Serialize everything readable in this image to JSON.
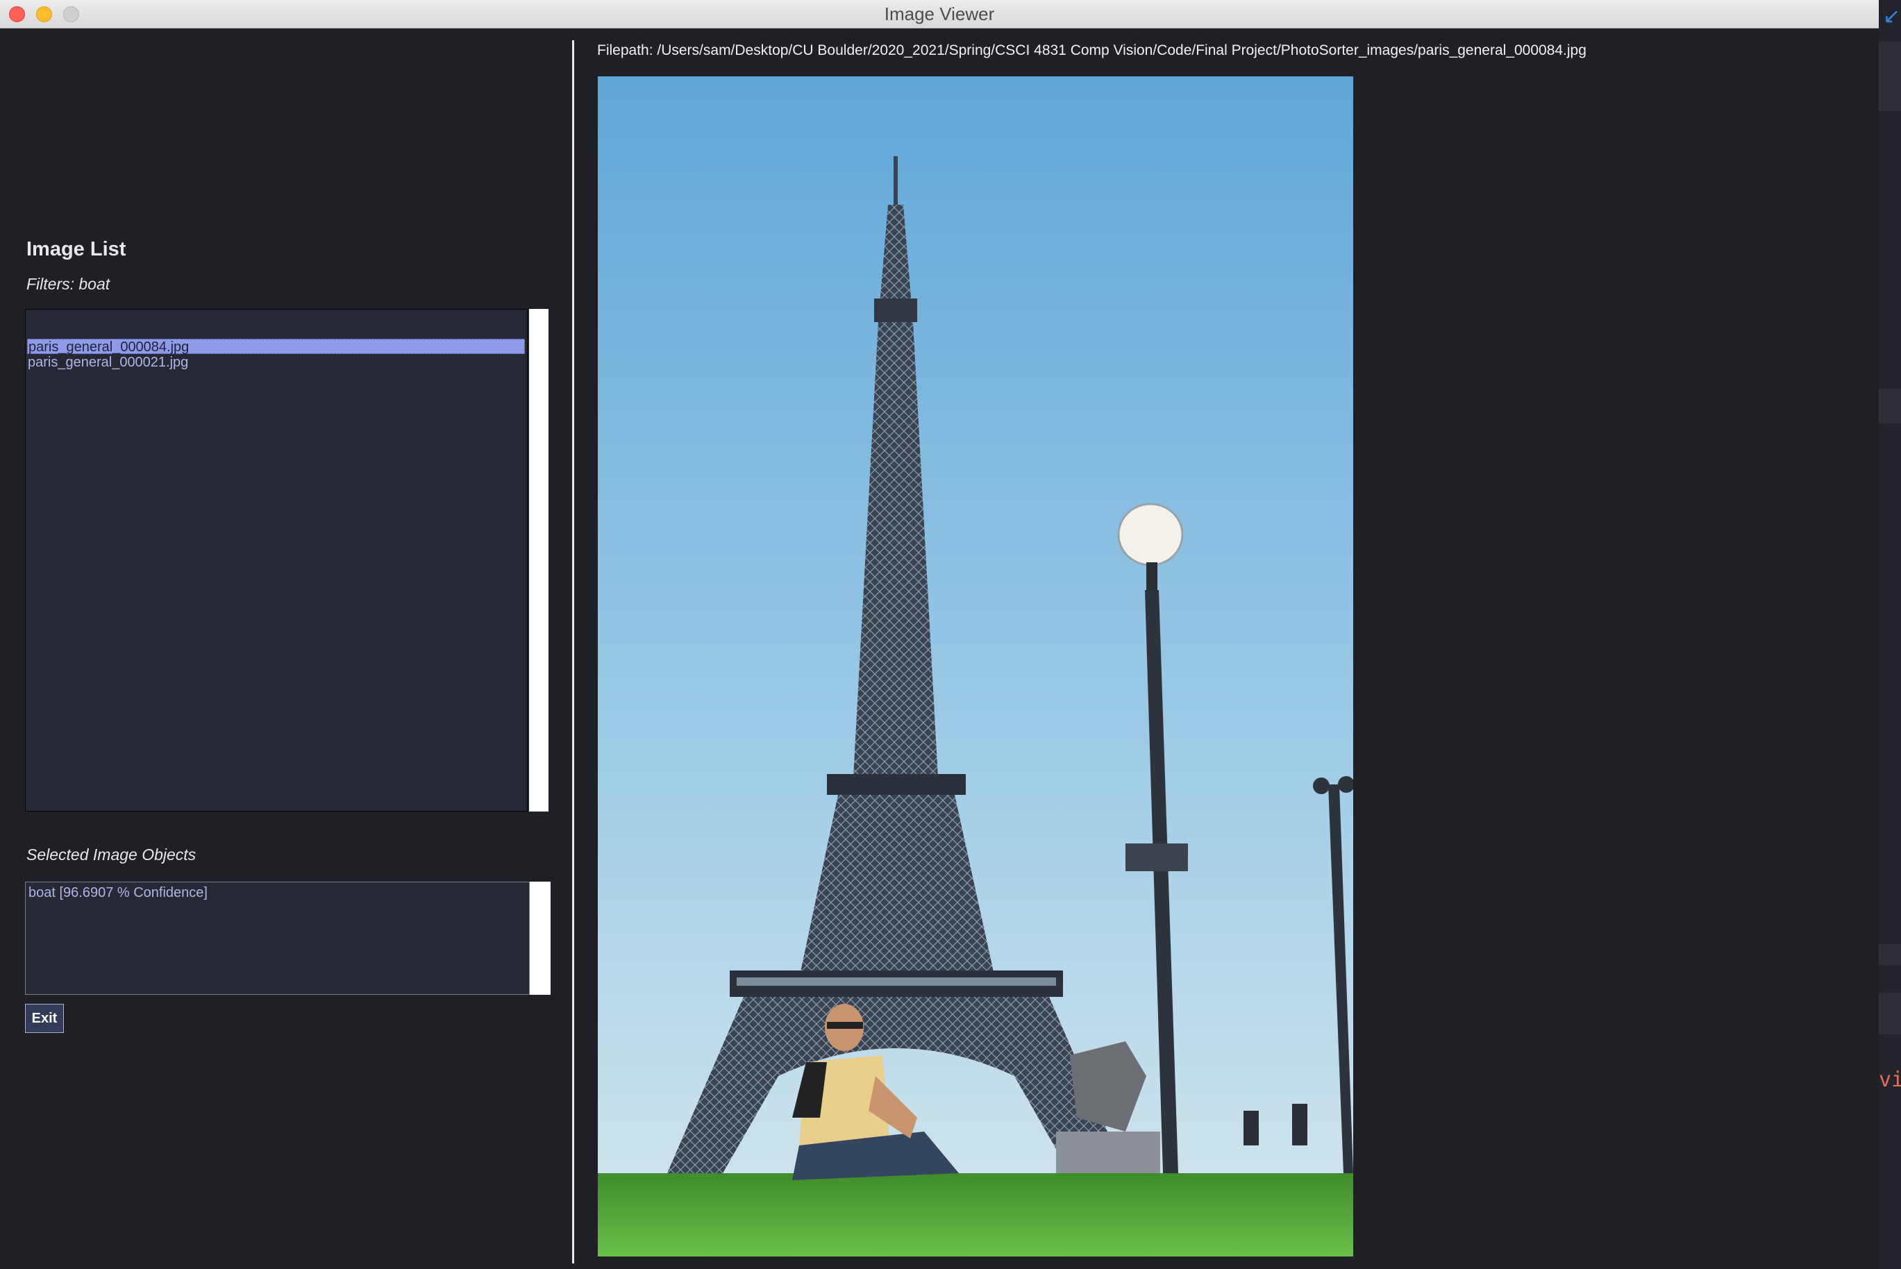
{
  "window": {
    "title": "Image Viewer"
  },
  "image_list": {
    "heading": "Image List",
    "filters": "Filters: boat",
    "items": [
      {
        "label": "paris_general_000084.jpg",
        "selected": true
      },
      {
        "label": "paris_general_000021.jpg",
        "selected": false
      }
    ]
  },
  "objects": {
    "label": "Selected Image Objects",
    "items": [
      "boat [96.6907 % Confidence]"
    ]
  },
  "buttons": {
    "exit": "Exit"
  },
  "viewer": {
    "filepath": "Filepath: /Users/sam/Desktop/CU Boulder/2020_2021/Spring/CSCI 4831 Comp Vision/Code/Final Project/PhotoSorter_images/paris_general_000084.jpg"
  },
  "editor_fragment": "vi",
  "colors": {
    "background": "#1f2026",
    "list_background": "#262833",
    "selection": "#8f9be6",
    "list_text": "#aeb6e8"
  },
  "icons": [
    "close-window-icon",
    "minimize-window-icon",
    "zoom-window-icon",
    "arrow-icon"
  ]
}
